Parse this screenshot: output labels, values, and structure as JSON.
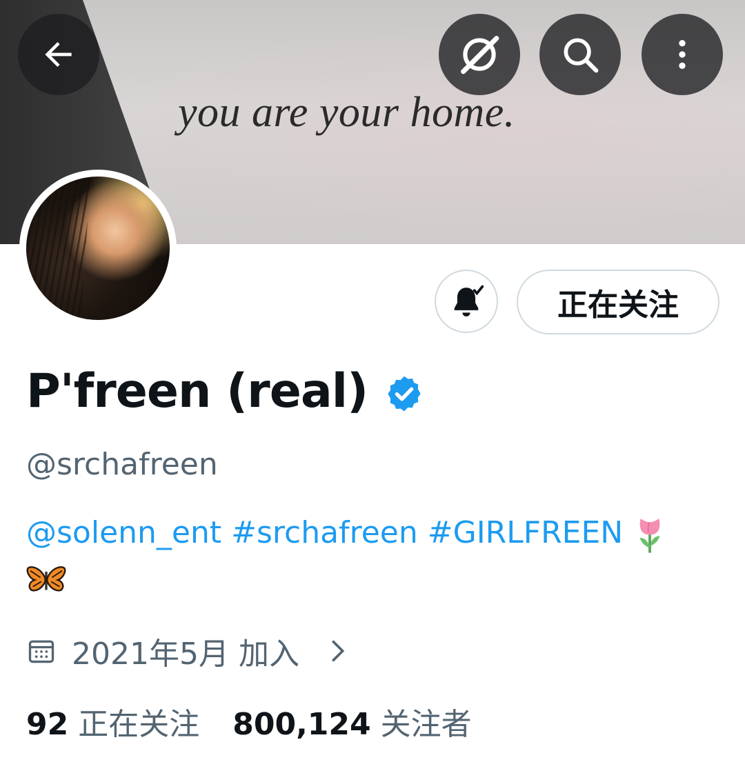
{
  "header": {
    "banner_caption": "you are your home.",
    "buttons": {
      "back": "arrow-left-icon",
      "grok": "grok-icon",
      "search": "search-icon",
      "more": "more-vertical-icon"
    }
  },
  "profile": {
    "display_name": "P'freen (real)",
    "verified": true,
    "handle": "@srchafreen",
    "bio_links": [
      "@solenn_ent",
      "#srchafreen",
      "#GIRLFREEN"
    ],
    "bio_emojis": [
      "tulip-emoji",
      "butterfly-emoji"
    ],
    "joined": "2021年5月 加入",
    "following_button": "正在关注",
    "notification_icon": "bell-check-icon"
  },
  "stats": {
    "following_count": "92",
    "following_label": "正在关注",
    "followers_count": "800,124",
    "followers_label": "关注者"
  },
  "colors": {
    "accent": "#1d9bf0",
    "text_primary": "#0f1419",
    "text_secondary": "#536471",
    "border": "#cfd9de"
  }
}
